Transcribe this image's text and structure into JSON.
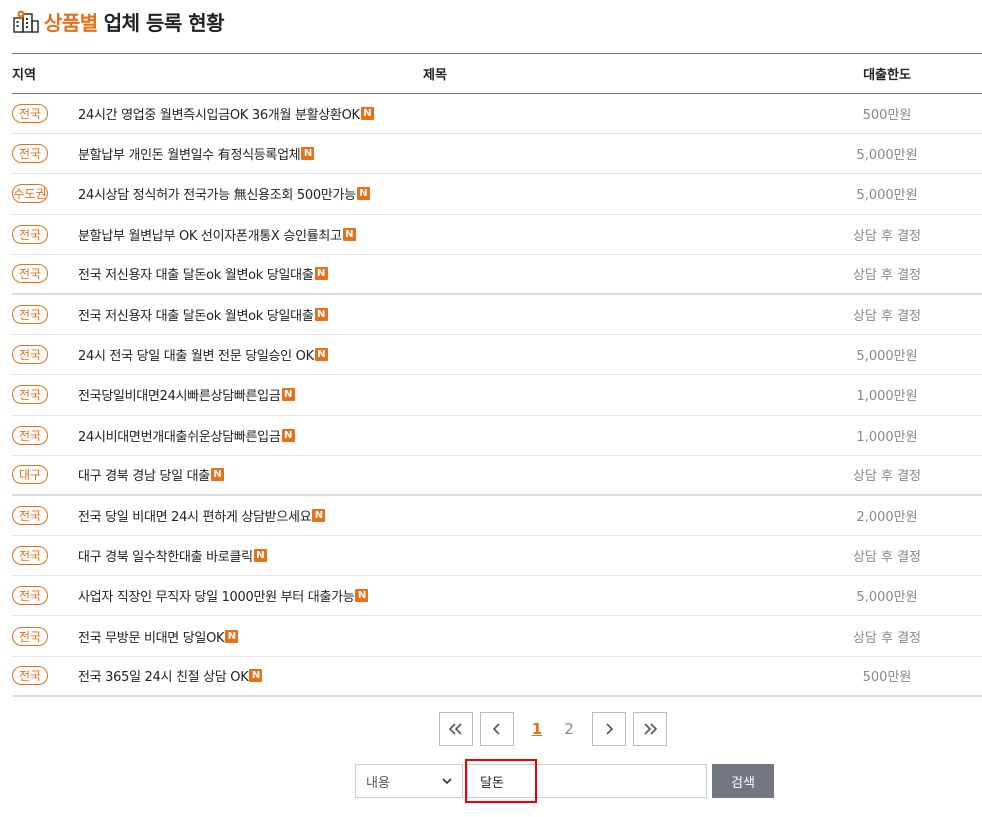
{
  "header": {
    "title_accent": "상품별",
    "title_rest": "업체 등록 현황"
  },
  "table": {
    "columns": {
      "region": "지역",
      "title": "제목",
      "limit": "대출한도"
    },
    "rows": [
      {
        "region": "전국",
        "title": "24시간 영업중 월변즉시입금OK 36개월 분활상환OK",
        "new": "N",
        "limit": "500만원"
      },
      {
        "region": "전국",
        "title": "분할납부 개인돈 월변일수 有정식등록업체",
        "new": "N",
        "limit": "5,000만원"
      },
      {
        "region": "수도권",
        "title": "24시상담 정식허가 전국가능 無신용조회 500만가능",
        "new": "N",
        "limit": "5,000만원"
      },
      {
        "region": "전국",
        "title": "분할납부 월변납부 OK 선이자폰개통X 승인률최고",
        "new": "N",
        "limit": "상담 후 결정"
      },
      {
        "region": "전국",
        "title": "전국 저신용자 대출 달돈ok 월변ok 당일대출",
        "new": "N",
        "limit": "상담 후 결정"
      },
      {
        "region": "전국",
        "title": "전국 저신용자 대출 달돈ok 월변ok 당일대출",
        "new": "N",
        "limit": "상담 후 결정"
      },
      {
        "region": "전국",
        "title": "24시 전국 당일 대출 월변 전문 당일승인 OK",
        "new": "N",
        "limit": "5,000만원"
      },
      {
        "region": "전국",
        "title": "전국당일비대면24시빠른상담빠른입금",
        "new": "N",
        "limit": "1,000만원"
      },
      {
        "region": "전국",
        "title": "24시비대면번개대출쉬운상담빠른입금",
        "new": "N",
        "limit": "1,000만원"
      },
      {
        "region": "대구",
        "title": "대구 경북 경남 당일 대출",
        "new": "N",
        "limit": "상담 후 결정"
      },
      {
        "region": "전국",
        "title": "전국 당일 비대면 24시 편하게 상담받으세요",
        "new": "N",
        "limit": "2,000만원"
      },
      {
        "region": "전국",
        "title": "대구 경북 일수착한대출 바로클릭",
        "new": "N",
        "limit": "상담 후 결정"
      },
      {
        "region": "전국",
        "title": "사업자 직장인 무직자 당일 1000만원 부터 대출가능",
        "new": "N",
        "limit": "5,000만원"
      },
      {
        "region": "전국",
        "title": "전국 무방문 비대면 당일OK",
        "new": "N",
        "limit": "상담 후 결정"
      },
      {
        "region": "전국",
        "title": "전국 365일 24시 친절 상담 OK ",
        "new": "N",
        "limit": "500만원"
      }
    ]
  },
  "pagination": {
    "first": "«",
    "prev": "‹",
    "pages": [
      "1",
      "2"
    ],
    "current": "1",
    "next": "›",
    "last": "»"
  },
  "search": {
    "field_option": "내용",
    "query": "달돈",
    "button": "검색"
  },
  "colors": {
    "accent": "#e8701a",
    "button_bg": "#737880",
    "highlight": "#e00000"
  }
}
